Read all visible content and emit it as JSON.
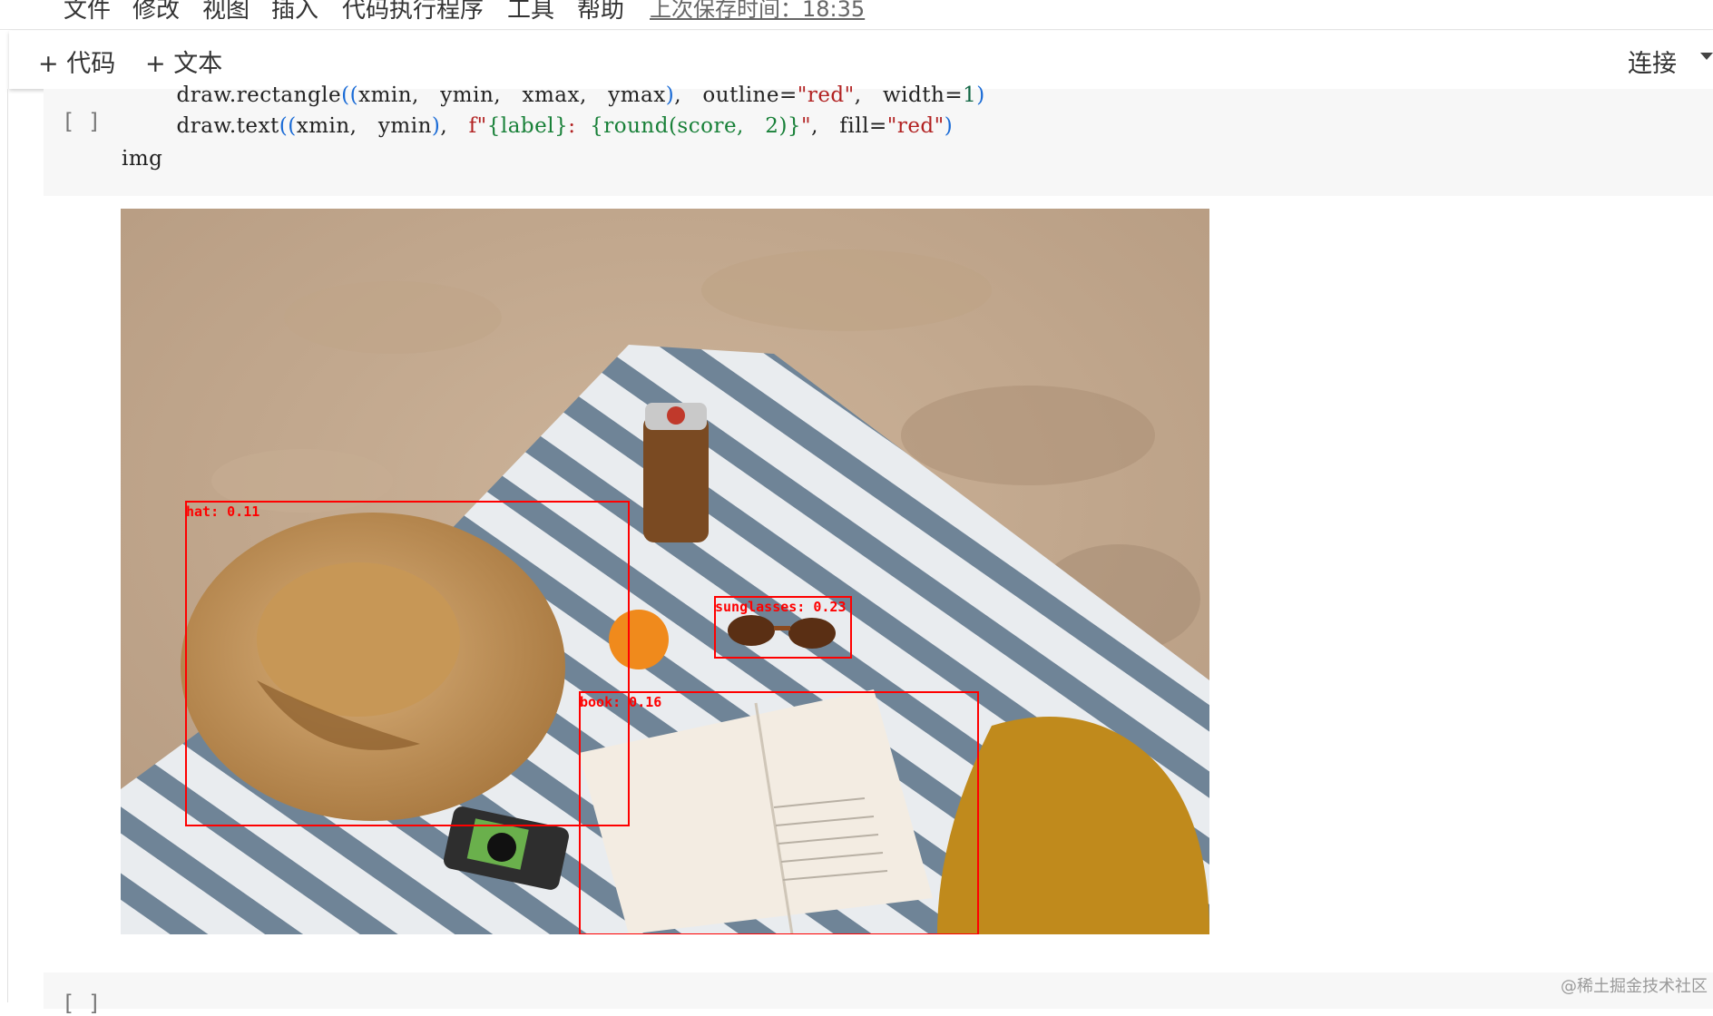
{
  "menu": {
    "items": [
      "文件",
      "修改",
      "视图",
      "插入",
      "代码执行程序",
      "工具",
      "帮助"
    ],
    "save_time": "上次保存时间：18:35"
  },
  "toolbar": {
    "add_code": "+ 代码",
    "add_text": "+ 文本",
    "connect": "连接"
  },
  "code_cell": {
    "bracket": "[ ]",
    "line1_prefix": "        draw.rectangle",
    "line1_paren_open": "((",
    "line1_args": "xmin,   ymin,   xmax,   ymax",
    "line1_paren_close": ")",
    "line1_sep": ",   outline=",
    "line1_str": "\"red\"",
    "line1_sep2": ",   width=",
    "line1_num": "1",
    "line1_end": ")",
    "line2_prefix": "        draw.text",
    "line2_paren_open": "((",
    "line2_args": "xmin,   ymin",
    "line2_paren_close": ")",
    "line2_sep": ",   ",
    "line2_f": "f\"",
    "line2_fmt1": "{label}",
    "line2_colon": ":  ",
    "line2_fmt2": "{round(score,   2)}",
    "line2_fq": "\"",
    "line2_sep2": ",   fill=",
    "line2_str": "\"red\"",
    "line2_end": ")",
    "line3": "img"
  },
  "detections": [
    {
      "label": "hat: 0.11"
    },
    {
      "label": "sunglasses: 0.23"
    },
    {
      "label": "book: 0.16"
    }
  ],
  "next_cell": {
    "bracket": "[ ]"
  },
  "watermark": "@稀土掘金技术社区"
}
